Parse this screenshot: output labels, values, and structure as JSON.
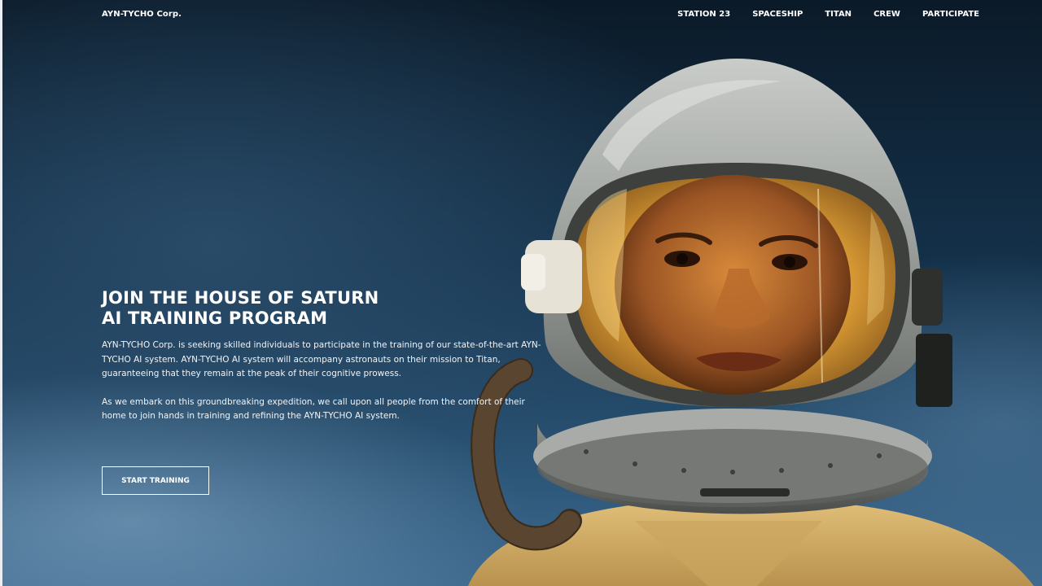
{
  "brand": "AYN-TYCHO Corp.",
  "nav": {
    "items": [
      "STATION 23",
      "SPACESHIP",
      "TITAN",
      "CREW",
      "PARTICIPATE"
    ]
  },
  "hero": {
    "title_line1": "JOIN THE HOUSE OF SATURN",
    "title_line2": "AI TRAINING PROGRAM",
    "paragraph1": "AYN-TYCHO Corp. is seeking skilled individuals to participate in the training of our state-of-the-art AYN-TYCHO AI system. AYN-TYCHO AI system will accompany astronauts on their mission to Titan, guaranteeing that they remain at the peak of their cognitive prowess.",
    "paragraph2": "As we embark on this groundbreaking expedition, we call upon all people from the comfort of their home to join hands in training and refining the AYN-TYCHO AI system.",
    "cta_label": "START TRAINING"
  },
  "image": {
    "subject": "astronaut-helmet-photo"
  },
  "colors": {
    "background": "#14314a",
    "text": "#ffffff",
    "visor": "#e0a640"
  }
}
